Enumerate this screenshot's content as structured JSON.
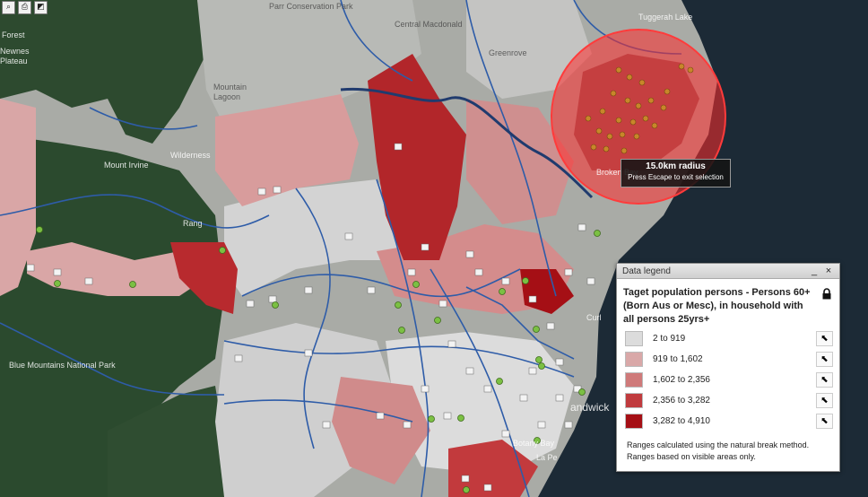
{
  "toolbar": {
    "tools": [
      "zoom-icon",
      "print-icon",
      "export-icon"
    ]
  },
  "map_labels": {
    "forest": "Forest",
    "newnes": "Newnes",
    "plateau": "Plateau",
    "wilderness": "Wilderness",
    "mountain": "Mountain",
    "lagoon": "Lagoon",
    "parr": "Parr Conservation Park",
    "central_macdonald": "Central Macdonald",
    "greenrove": "Greenrove",
    "tuggerah_lake": "Tuggerah Lake",
    "blue_mountains": "Blue Mountains National Park",
    "randwick": "andwick",
    "curl": "Curl",
    "broken_bay": "Broken Bay",
    "la_pe": "La Pe",
    "botany_bay": "Botany Bay",
    "ranges": "Rang",
    "mount": "Mount Irvine"
  },
  "selection": {
    "radius_label": "15.0km radius",
    "hint": "Press Escape to exit selection"
  },
  "legend": {
    "header": "Data legend",
    "minimize": "_",
    "close": "×",
    "title": "Taget population persons - Persons  60+ (Born Aus or Mesc), in household with all persons 25yrs+",
    "ranges": [
      {
        "label": "2 to 919",
        "color": "#dcdcdc"
      },
      {
        "label": "919 to 1,602",
        "color": "#d9a8a8"
      },
      {
        "label": "1,602 to 2,356",
        "color": "#cf7a7a"
      },
      {
        "label": "2,356 to 3,282",
        "color": "#c03b3e"
      },
      {
        "label": "3,282 to 4,910",
        "color": "#a50f15"
      }
    ],
    "note": "Ranges calculated using the natural break method. Ranges based on visible areas only."
  },
  "colors": {
    "boundary": "#2e5ca8",
    "forest": "#2c4a30",
    "selection": "#ff3333",
    "poi": "#7bc043"
  }
}
